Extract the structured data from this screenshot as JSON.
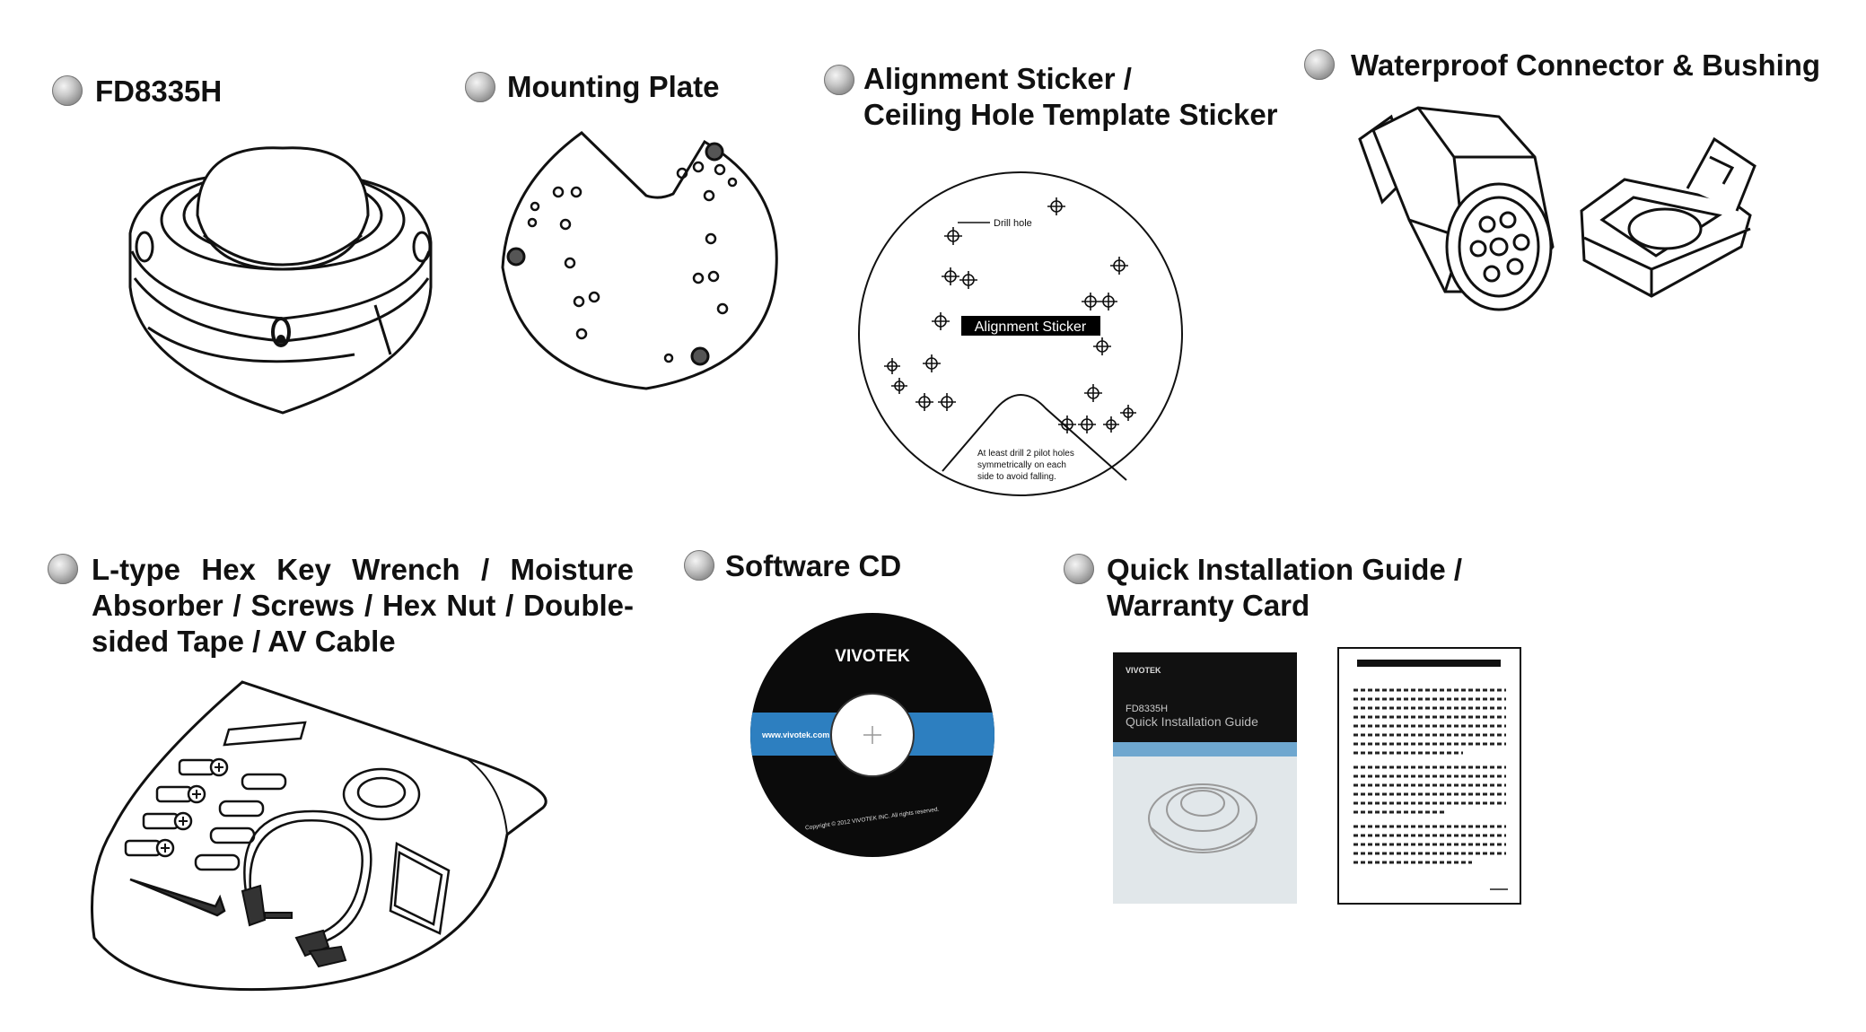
{
  "items": {
    "camera": {
      "title": "FD8335H",
      "icon": "dome-camera-icon"
    },
    "plate": {
      "title": "Mounting Plate",
      "icon": "mounting-plate-icon"
    },
    "sticker": {
      "title_line1": "Alignment Sticker /",
      "title_line2": "Ceiling Hole Template Sticker",
      "drill_label": "Drill hole",
      "center_label": "Alignment Sticker",
      "note": [
        "At least drill 2 pilot holes",
        "symmetrically on each",
        "side to avoid falling."
      ]
    },
    "connector": {
      "title": "Waterproof Connector & Bushing",
      "icon": "waterproof-connector-icon"
    },
    "accessories": {
      "title": "L-type Hex Key Wrench / Moisture Absorber / Screws / Hex Nut / Double-sided Tape / AV Cable",
      "icon": "accessory-bag-icon"
    },
    "cd": {
      "title": "Software CD",
      "brand": "VIVOTEK",
      "url": "www.vivotek.com",
      "copyright": "Copyright © 2012 VIVOTEK INC. All rights reserved."
    },
    "guide": {
      "title_line1": "Quick Installation Guide /",
      "title_line2": "Warranty Card",
      "brand": "VIVOTEK",
      "model": "FD8335H",
      "subtitle": "Quick Installation Guide"
    }
  },
  "colors": {
    "cd_band": "#2d7fc0",
    "cd_body": "#0b0b0b",
    "bullet": "#9a9a9a"
  }
}
